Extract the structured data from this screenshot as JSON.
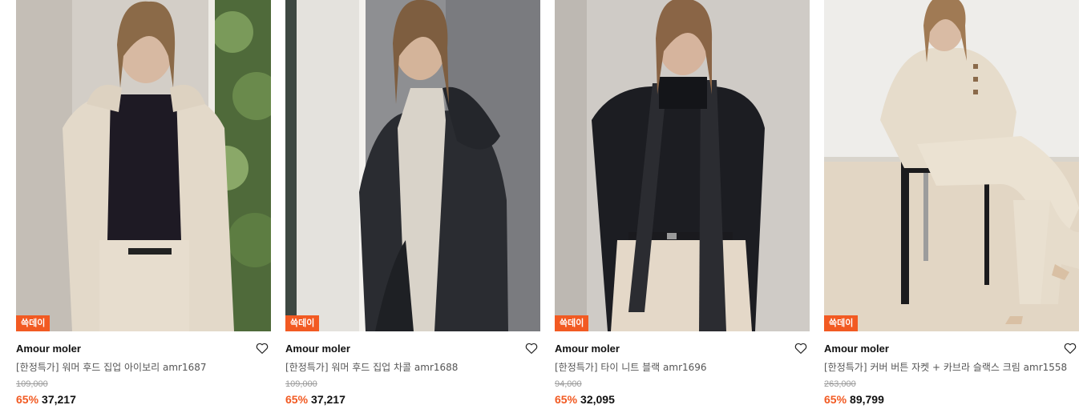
{
  "products": [
    {
      "badge": "쓱데이",
      "brand": "Amour moler",
      "title": "[한정특가] 워머 후드 집업 아이보리 amr1687",
      "original_price": "109,000",
      "discount": "65%",
      "price": "37,217",
      "image_subject": "model in ivory hooded zip-up over black turtleneck",
      "colors": {
        "bg": "#cfcac3",
        "garment": "#e2d8c8",
        "inner": "#1e1a22",
        "pants": "#e6dccd"
      }
    },
    {
      "badge": "쓱데이",
      "brand": "Amour moler",
      "title": "[한정특가] 워머 후드 집업 차콜 amr1688",
      "original_price": "109,000",
      "discount": "65%",
      "price": "37,217",
      "image_subject": "model in charcoal hooded zip-up over light turtleneck",
      "colors": {
        "bg": "#8f9092",
        "garment": "#2a2c31",
        "inner": "#d8d2c8",
        "pants": "#2a2c31"
      }
    },
    {
      "badge": "쓱데이",
      "brand": "Amour moler",
      "title": "[한정특가] 타이 니트 블랙 amr1696",
      "original_price": "94,000",
      "discount": "65%",
      "price": "32,095",
      "image_subject": "model in black tie knit with beige trousers",
      "colors": {
        "bg": "#cfcbc6",
        "garment": "#1c1d22",
        "inner": "#111216",
        "pants": "#e4d8c8"
      }
    },
    {
      "badge": "쓱데이",
      "brand": "Amour moler",
      "title": "[한정특가] 커버 버튼 자켓 + 카브라 슬랙스 크림 amr1558",
      "original_price": "263,000",
      "discount": "65%",
      "price": "89,799",
      "image_subject": "model seated in cream jacket and wide slacks",
      "colors": {
        "bg": "#ecebe8",
        "garment": "#e7ddcc",
        "inner": "#a09a92",
        "pants": "#e9e0d0"
      }
    }
  ]
}
